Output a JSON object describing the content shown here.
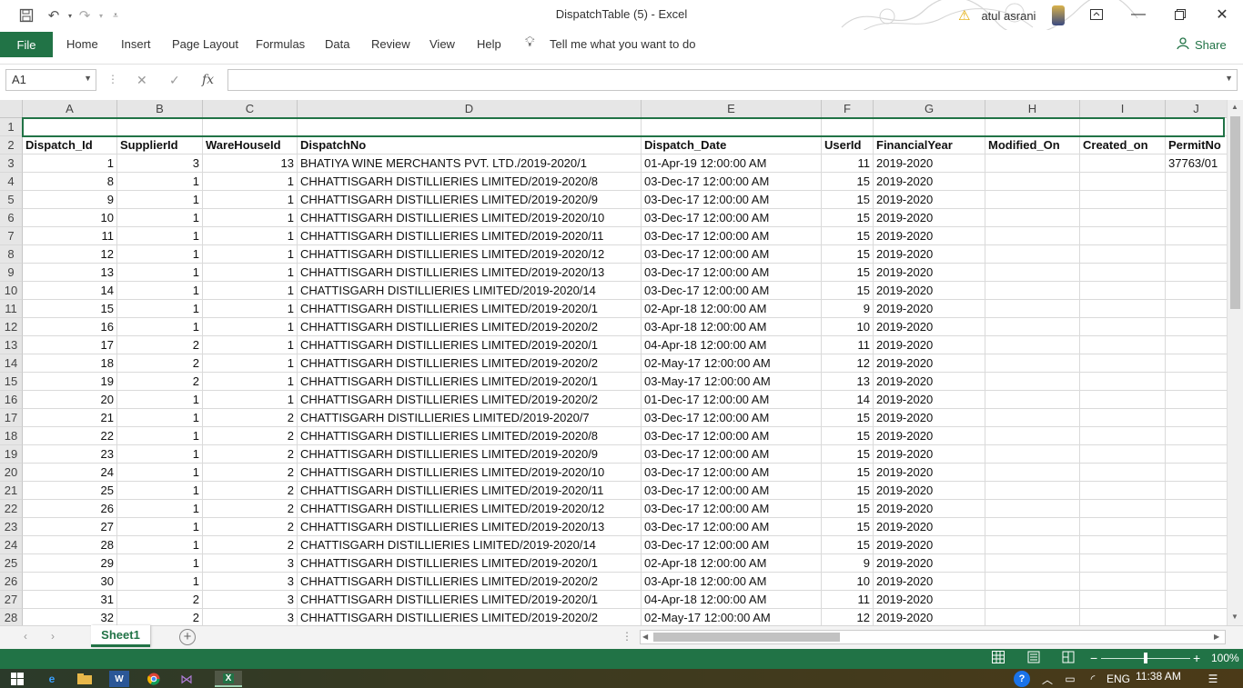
{
  "window": {
    "title": "DispatchTable (5)  -  Excel",
    "user": "atul asrani"
  },
  "ribbon": {
    "file": "File",
    "tabs": [
      "Home",
      "Insert",
      "Page Layout",
      "Formulas",
      "Data",
      "Review",
      "View",
      "Help"
    ],
    "tell_me": "Tell me what you want to do",
    "share": "Share"
  },
  "formula_bar": {
    "name_box": "A1",
    "fx": "fx",
    "value": ""
  },
  "sheet": {
    "columns": [
      "A",
      "B",
      "C",
      "D",
      "E",
      "F",
      "G",
      "H",
      "I",
      "J"
    ],
    "header_row": [
      "Dispatch_Id",
      "SupplierId",
      "WareHouseId",
      "DispatchNo",
      "Dispatch_Date",
      "UserId",
      "FinancialYear",
      "Modified_On",
      "Created_on",
      "PermitNo"
    ],
    "rows": [
      [
        "1",
        "3",
        "13",
        "BHATIYA WINE MERCHANTS PVT. LTD./2019-2020/1",
        "01-Apr-19 12:00:00 AM",
        "11",
        "2019-2020",
        "",
        "",
        "37763/01"
      ],
      [
        "8",
        "1",
        "1",
        "CHHATTISGARH DISTILLIERIES LIMITED/2019-2020/8",
        "03-Dec-17 12:00:00 AM",
        "15",
        "2019-2020",
        "",
        "",
        ""
      ],
      [
        "9",
        "1",
        "1",
        "CHHATTISGARH DISTILLIERIES LIMITED/2019-2020/9",
        "03-Dec-17 12:00:00 AM",
        "15",
        "2019-2020",
        "",
        "",
        ""
      ],
      [
        "10",
        "1",
        "1",
        "CHHATTISGARH DISTILLIERIES LIMITED/2019-2020/10",
        "03-Dec-17 12:00:00 AM",
        "15",
        "2019-2020",
        "",
        "",
        ""
      ],
      [
        "11",
        "1",
        "1",
        "CHHATTISGARH DISTILLIERIES LIMITED/2019-2020/11",
        "03-Dec-17 12:00:00 AM",
        "15",
        "2019-2020",
        "",
        "",
        ""
      ],
      [
        "12",
        "1",
        "1",
        "CHHATTISGARH DISTILLIERIES LIMITED/2019-2020/12",
        "03-Dec-17 12:00:00 AM",
        "15",
        "2019-2020",
        "",
        "",
        ""
      ],
      [
        "13",
        "1",
        "1",
        "CHHATTISGARH DISTILLIERIES LIMITED/2019-2020/13",
        "03-Dec-17 12:00:00 AM",
        "15",
        "2019-2020",
        "",
        "",
        ""
      ],
      [
        "14",
        "1",
        "1",
        "CHATTISGARH DISTILLIERIES LIMITED/2019-2020/14",
        "03-Dec-17 12:00:00 AM",
        "15",
        "2019-2020",
        "",
        "",
        ""
      ],
      [
        "15",
        "1",
        "1",
        "CHHATTISGARH DISTILLIERIES LIMITED/2019-2020/1",
        "02-Apr-18 12:00:00 AM",
        "9",
        "2019-2020",
        "",
        "",
        ""
      ],
      [
        "16",
        "1",
        "1",
        "CHHATTISGARH DISTILLIERIES LIMITED/2019-2020/2",
        "03-Apr-18 12:00:00 AM",
        "10",
        "2019-2020",
        "",
        "",
        ""
      ],
      [
        "17",
        "2",
        "1",
        "CHHATTISGARH DISTILLIERIES LIMITED/2019-2020/1",
        "04-Apr-18 12:00:00 AM",
        "11",
        "2019-2020",
        "",
        "",
        ""
      ],
      [
        "18",
        "2",
        "1",
        "CHHATTISGARH DISTILLIERIES LIMITED/2019-2020/2",
        "02-May-17 12:00:00 AM",
        "12",
        "2019-2020",
        "",
        "",
        ""
      ],
      [
        "19",
        "2",
        "1",
        "CHHATTISGARH DISTILLIERIES LIMITED/2019-2020/1",
        "03-May-17 12:00:00 AM",
        "13",
        "2019-2020",
        "",
        "",
        ""
      ],
      [
        "20",
        "1",
        "1",
        "CHHATTISGARH DISTILLIERIES LIMITED/2019-2020/2",
        "01-Dec-17 12:00:00 AM",
        "14",
        "2019-2020",
        "",
        "",
        ""
      ],
      [
        "21",
        "1",
        "2",
        "CHATTISGARH DISTILLIERIES LIMITED/2019-2020/7",
        "03-Dec-17 12:00:00 AM",
        "15",
        "2019-2020",
        "",
        "",
        ""
      ],
      [
        "22",
        "1",
        "2",
        "CHHATTISGARH DISTILLIERIES LIMITED/2019-2020/8",
        "03-Dec-17 12:00:00 AM",
        "15",
        "2019-2020",
        "",
        "",
        ""
      ],
      [
        "23",
        "1",
        "2",
        "CHHATTISGARH DISTILLIERIES LIMITED/2019-2020/9",
        "03-Dec-17 12:00:00 AM",
        "15",
        "2019-2020",
        "",
        "",
        ""
      ],
      [
        "24",
        "1",
        "2",
        "CHHATTISGARH DISTILLIERIES LIMITED/2019-2020/10",
        "03-Dec-17 12:00:00 AM",
        "15",
        "2019-2020",
        "",
        "",
        ""
      ],
      [
        "25",
        "1",
        "2",
        "CHHATTISGARH DISTILLIERIES LIMITED/2019-2020/11",
        "03-Dec-17 12:00:00 AM",
        "15",
        "2019-2020",
        "",
        "",
        ""
      ],
      [
        "26",
        "1",
        "2",
        "CHHATTISGARH DISTILLIERIES LIMITED/2019-2020/12",
        "03-Dec-17 12:00:00 AM",
        "15",
        "2019-2020",
        "",
        "",
        ""
      ],
      [
        "27",
        "1",
        "2",
        "CHHATTISGARH DISTILLIERIES LIMITED/2019-2020/13",
        "03-Dec-17 12:00:00 AM",
        "15",
        "2019-2020",
        "",
        "",
        ""
      ],
      [
        "28",
        "1",
        "2",
        "CHATTISGARH DISTILLIERIES LIMITED/2019-2020/14",
        "03-Dec-17 12:00:00 AM",
        "15",
        "2019-2020",
        "",
        "",
        ""
      ],
      [
        "29",
        "1",
        "3",
        "CHHATTISGARH DISTILLIERIES LIMITED/2019-2020/1",
        "02-Apr-18 12:00:00 AM",
        "9",
        "2019-2020",
        "",
        "",
        ""
      ],
      [
        "30",
        "1",
        "3",
        "CHHATTISGARH DISTILLIERIES LIMITED/2019-2020/2",
        "03-Apr-18 12:00:00 AM",
        "10",
        "2019-2020",
        "",
        "",
        ""
      ],
      [
        "31",
        "2",
        "3",
        "CHHATTISGARH DISTILLIERIES LIMITED/2019-2020/1",
        "04-Apr-18 12:00:00 AM",
        "11",
        "2019-2020",
        "",
        "",
        ""
      ],
      [
        "32",
        "2",
        "3",
        "CHHATTISGARH DISTILLIERIES LIMITED/2019-2020/2",
        "02-May-17 12:00:00 AM",
        "12",
        "2019-2020",
        "",
        "",
        ""
      ]
    ]
  },
  "sheet_tabs": {
    "active": "Sheet1"
  },
  "status_bar": {
    "zoom": "100%"
  },
  "taskbar": {
    "lang": "ENG",
    "time": "11:38 AM"
  },
  "colors": {
    "accent": "#217346"
  },
  "icons": [
    "save-icon",
    "undo-icon",
    "redo-icon",
    "customize-icon",
    "warning-icon",
    "lightbulb-icon",
    "share-person-icon",
    "cancel-icon",
    "enter-icon",
    "function-icon",
    "add-sheet-icon",
    "normal-view-icon",
    "page-layout-icon",
    "page-break-icon",
    "windows-start-icon"
  ]
}
